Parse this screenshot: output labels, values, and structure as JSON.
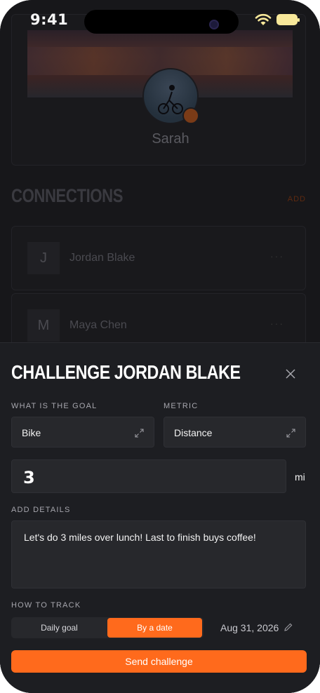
{
  "status_bar": {
    "time": "9:41"
  },
  "profile": {
    "name": "Sarah"
  },
  "connections": {
    "title": "CONNECTIONS",
    "add_label": "ADD",
    "items": [
      {
        "initial": "J",
        "name": "Jordan Blake"
      },
      {
        "initial": "M",
        "name": "Maya Chen"
      }
    ]
  },
  "sheet": {
    "title": "CHALLENGE JORDAN BLAKE",
    "goal_label": "WHAT IS THE GOAL",
    "goal_value": "Bike",
    "metric_label": "METRIC",
    "metric_value": "Distance",
    "amount_value": "3",
    "unit": "mi",
    "details_label": "ADD DETAILS",
    "details_value": "Let's do 3 miles over lunch! Last to finish buys coffee!",
    "track_label": "HOW TO TRACK",
    "track_options": [
      "Daily goal",
      "By a date"
    ],
    "track_selected": "By a date",
    "date_value": "Aug 31, 2026",
    "send_label": "Send challenge"
  },
  "colors": {
    "accent": "#ff6a1c",
    "sheet_bg": "#1d1e22",
    "field_bg": "#27282c"
  }
}
